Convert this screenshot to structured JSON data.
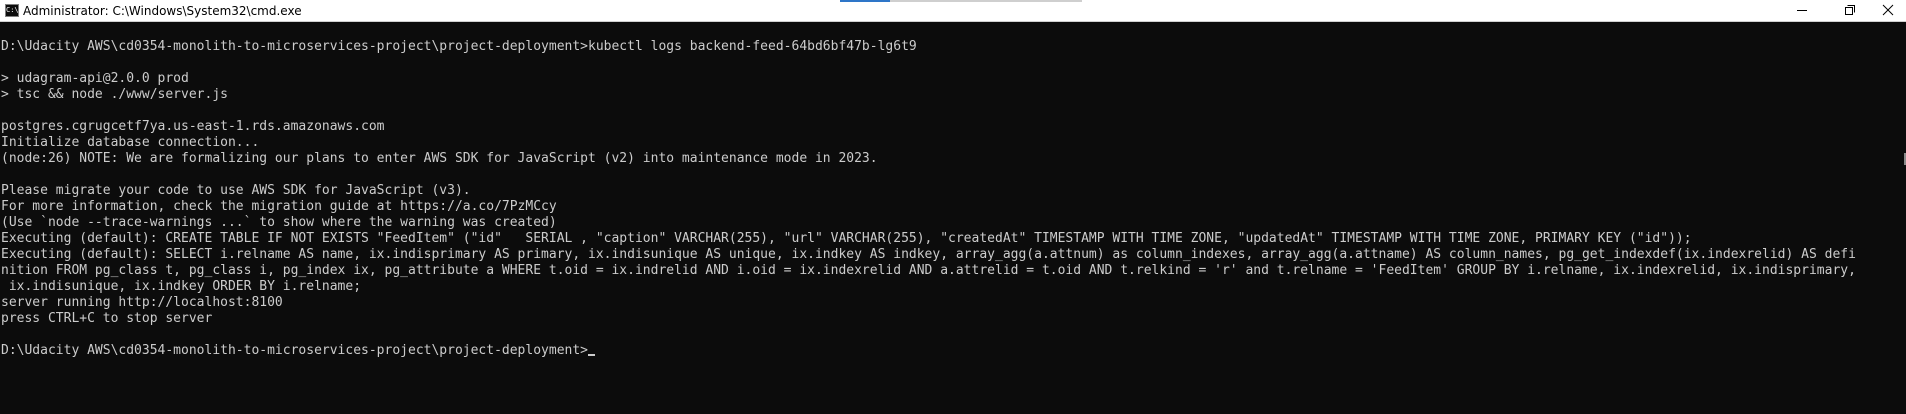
{
  "window": {
    "title": "Administrator: C:\\Windows\\System32\\cmd.exe",
    "app_icon_glyph": "C:\\",
    "titlebar_bg": "#ffffff",
    "console_bg": "#0c0c0c",
    "console_fg": "#cccccc"
  },
  "icons": {
    "app": "command-prompt-icon",
    "minimize": "minimize-icon",
    "maximize": "maximize-icon",
    "close": "close-icon"
  },
  "console": {
    "lines": [
      "D:\\Udacity AWS\\cd0354-monolith-to-microservices-project\\project-deployment>kubectl logs backend-feed-64bd6bf47b-lg6t9",
      "",
      "> udagram-api@2.0.0 prod",
      "> tsc && node ./www/server.js",
      "",
      "postgres.cgrugcetf7ya.us-east-1.rds.amazonaws.com",
      "Initialize database connection...",
      "(node:26) NOTE: We are formalizing our plans to enter AWS SDK for JavaScript (v2) into maintenance mode in 2023.",
      "",
      "Please migrate your code to use AWS SDK for JavaScript (v3).",
      "For more information, check the migration guide at https://a.co/7PzMCcy",
      "(Use `node --trace-warnings ...` to show where the warning was created)",
      "Executing (default): CREATE TABLE IF NOT EXISTS \"FeedItem\" (\"id\"   SERIAL , \"caption\" VARCHAR(255), \"url\" VARCHAR(255), \"createdAt\" TIMESTAMP WITH TIME ZONE, \"updatedAt\" TIMESTAMP WITH TIME ZONE, PRIMARY KEY (\"id\"));",
      "Executing (default): SELECT i.relname AS name, ix.indisprimary AS primary, ix.indisunique AS unique, ix.indkey AS indkey, array_agg(a.attnum) as column_indexes, array_agg(a.attname) AS column_names, pg_get_indexdef(ix.indexrelid) AS defi",
      "nition FROM pg_class t, pg_class i, pg_index ix, pg_attribute a WHERE t.oid = ix.indrelid AND i.oid = ix.indexrelid AND a.attrelid = t.oid AND t.relkind = 'r' and t.relname = 'FeedItem' GROUP BY i.relname, ix.indexrelid, ix.indisprimary,",
      " ix.indisunique, ix.indkey ORDER BY i.relname;",
      "server running http://localhost:8100",
      "press CTRL+C to stop server",
      ""
    ],
    "prompt": "D:\\Udacity AWS\\cd0354-monolith-to-microservices-project\\project-deployment>"
  }
}
